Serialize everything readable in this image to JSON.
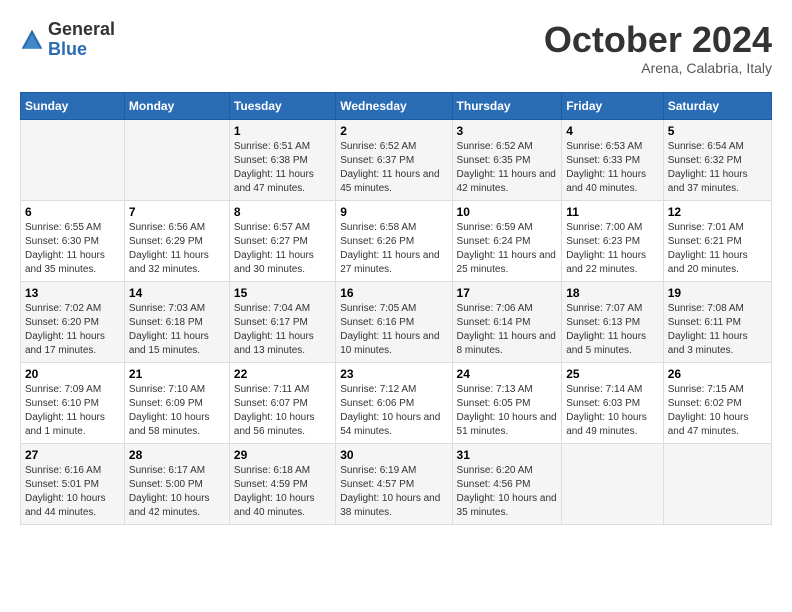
{
  "header": {
    "logo_general": "General",
    "logo_blue": "Blue",
    "month_title": "October 2024",
    "subtitle": "Arena, Calabria, Italy"
  },
  "columns": [
    "Sunday",
    "Monday",
    "Tuesday",
    "Wednesday",
    "Thursday",
    "Friday",
    "Saturday"
  ],
  "weeks": [
    [
      {
        "day": "",
        "info": ""
      },
      {
        "day": "",
        "info": ""
      },
      {
        "day": "1",
        "info": "Sunrise: 6:51 AM\nSunset: 6:38 PM\nDaylight: 11 hours and 47 minutes."
      },
      {
        "day": "2",
        "info": "Sunrise: 6:52 AM\nSunset: 6:37 PM\nDaylight: 11 hours and 45 minutes."
      },
      {
        "day": "3",
        "info": "Sunrise: 6:52 AM\nSunset: 6:35 PM\nDaylight: 11 hours and 42 minutes."
      },
      {
        "day": "4",
        "info": "Sunrise: 6:53 AM\nSunset: 6:33 PM\nDaylight: 11 hours and 40 minutes."
      },
      {
        "day": "5",
        "info": "Sunrise: 6:54 AM\nSunset: 6:32 PM\nDaylight: 11 hours and 37 minutes."
      }
    ],
    [
      {
        "day": "6",
        "info": "Sunrise: 6:55 AM\nSunset: 6:30 PM\nDaylight: 11 hours and 35 minutes."
      },
      {
        "day": "7",
        "info": "Sunrise: 6:56 AM\nSunset: 6:29 PM\nDaylight: 11 hours and 32 minutes."
      },
      {
        "day": "8",
        "info": "Sunrise: 6:57 AM\nSunset: 6:27 PM\nDaylight: 11 hours and 30 minutes."
      },
      {
        "day": "9",
        "info": "Sunrise: 6:58 AM\nSunset: 6:26 PM\nDaylight: 11 hours and 27 minutes."
      },
      {
        "day": "10",
        "info": "Sunrise: 6:59 AM\nSunset: 6:24 PM\nDaylight: 11 hours and 25 minutes."
      },
      {
        "day": "11",
        "info": "Sunrise: 7:00 AM\nSunset: 6:23 PM\nDaylight: 11 hours and 22 minutes."
      },
      {
        "day": "12",
        "info": "Sunrise: 7:01 AM\nSunset: 6:21 PM\nDaylight: 11 hours and 20 minutes."
      }
    ],
    [
      {
        "day": "13",
        "info": "Sunrise: 7:02 AM\nSunset: 6:20 PM\nDaylight: 11 hours and 17 minutes."
      },
      {
        "day": "14",
        "info": "Sunrise: 7:03 AM\nSunset: 6:18 PM\nDaylight: 11 hours and 15 minutes."
      },
      {
        "day": "15",
        "info": "Sunrise: 7:04 AM\nSunset: 6:17 PM\nDaylight: 11 hours and 13 minutes."
      },
      {
        "day": "16",
        "info": "Sunrise: 7:05 AM\nSunset: 6:16 PM\nDaylight: 11 hours and 10 minutes."
      },
      {
        "day": "17",
        "info": "Sunrise: 7:06 AM\nSunset: 6:14 PM\nDaylight: 11 hours and 8 minutes."
      },
      {
        "day": "18",
        "info": "Sunrise: 7:07 AM\nSunset: 6:13 PM\nDaylight: 11 hours and 5 minutes."
      },
      {
        "day": "19",
        "info": "Sunrise: 7:08 AM\nSunset: 6:11 PM\nDaylight: 11 hours and 3 minutes."
      }
    ],
    [
      {
        "day": "20",
        "info": "Sunrise: 7:09 AM\nSunset: 6:10 PM\nDaylight: 11 hours and 1 minute."
      },
      {
        "day": "21",
        "info": "Sunrise: 7:10 AM\nSunset: 6:09 PM\nDaylight: 10 hours and 58 minutes."
      },
      {
        "day": "22",
        "info": "Sunrise: 7:11 AM\nSunset: 6:07 PM\nDaylight: 10 hours and 56 minutes."
      },
      {
        "day": "23",
        "info": "Sunrise: 7:12 AM\nSunset: 6:06 PM\nDaylight: 10 hours and 54 minutes."
      },
      {
        "day": "24",
        "info": "Sunrise: 7:13 AM\nSunset: 6:05 PM\nDaylight: 10 hours and 51 minutes."
      },
      {
        "day": "25",
        "info": "Sunrise: 7:14 AM\nSunset: 6:03 PM\nDaylight: 10 hours and 49 minutes."
      },
      {
        "day": "26",
        "info": "Sunrise: 7:15 AM\nSunset: 6:02 PM\nDaylight: 10 hours and 47 minutes."
      }
    ],
    [
      {
        "day": "27",
        "info": "Sunrise: 6:16 AM\nSunset: 5:01 PM\nDaylight: 10 hours and 44 minutes."
      },
      {
        "day": "28",
        "info": "Sunrise: 6:17 AM\nSunset: 5:00 PM\nDaylight: 10 hours and 42 minutes."
      },
      {
        "day": "29",
        "info": "Sunrise: 6:18 AM\nSunset: 4:59 PM\nDaylight: 10 hours and 40 minutes."
      },
      {
        "day": "30",
        "info": "Sunrise: 6:19 AM\nSunset: 4:57 PM\nDaylight: 10 hours and 38 minutes."
      },
      {
        "day": "31",
        "info": "Sunrise: 6:20 AM\nSunset: 4:56 PM\nDaylight: 10 hours and 35 minutes."
      },
      {
        "day": "",
        "info": ""
      },
      {
        "day": "",
        "info": ""
      }
    ]
  ]
}
